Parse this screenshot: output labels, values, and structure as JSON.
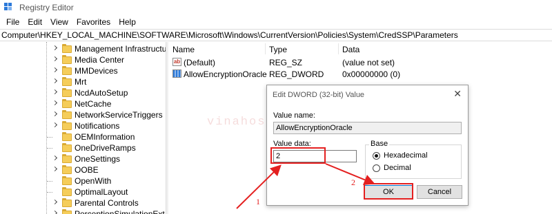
{
  "window": {
    "title": "Registry Editor",
    "accent": "#2b79d9"
  },
  "menu": [
    "File",
    "Edit",
    "View",
    "Favorites",
    "Help"
  ],
  "address": "Computer\\HKEY_LOCAL_MACHINE\\SOFTWARE\\Microsoft\\Windows\\CurrentVersion\\Policies\\System\\CredSSP\\Parameters",
  "tree": {
    "items": [
      {
        "label": "Management Infrastructu",
        "expandable": true
      },
      {
        "label": "Media Center",
        "expandable": true
      },
      {
        "label": "MMDevices",
        "expandable": true
      },
      {
        "label": "Mrt",
        "expandable": true
      },
      {
        "label": "NcdAutoSetup",
        "expandable": true
      },
      {
        "label": "NetCache",
        "expandable": true
      },
      {
        "label": "NetworkServiceTriggers",
        "expandable": true
      },
      {
        "label": "Notifications",
        "expandable": true
      },
      {
        "label": "OEMInformation",
        "expandable": false
      },
      {
        "label": "OneDriveRamps",
        "expandable": false
      },
      {
        "label": "OneSettings",
        "expandable": true
      },
      {
        "label": "OOBE",
        "expandable": true
      },
      {
        "label": "OpenWith",
        "expandable": false
      },
      {
        "label": "OptimalLayout",
        "expandable": false
      },
      {
        "label": "Parental Controls",
        "expandable": true
      },
      {
        "label": "PerceptionSimulationExt",
        "expandable": true
      }
    ]
  },
  "list": {
    "headers": {
      "name": "Name",
      "type": "Type",
      "data": "Data"
    },
    "rows": [
      {
        "icon": "string-value-icon",
        "icon_text": "ab",
        "name": "(Default)",
        "type": "REG_SZ",
        "data": "(value not set)"
      },
      {
        "icon": "dword-value-icon",
        "icon_text": "",
        "name": "AllowEncryptionOracle",
        "type": "REG_DWORD",
        "data": "0x00000000 (0)"
      }
    ]
  },
  "watermark": "vinahost.vn",
  "dialog": {
    "title": "Edit DWORD (32-bit) Value",
    "close_glyph": "✕",
    "value_name_label": "Value name:",
    "value_name": "AllowEncryptionOracle",
    "value_data_label": "Value data:",
    "value_data": "2",
    "base_label": "Base",
    "hex_label": "Hexadecimal",
    "dec_label": "Decimal",
    "base_selected": "Hexadecimal",
    "ok_label": "OK",
    "cancel_label": "Cancel"
  },
  "annotations": {
    "step1": "1",
    "step2": "2",
    "color": "#e41f1f"
  }
}
